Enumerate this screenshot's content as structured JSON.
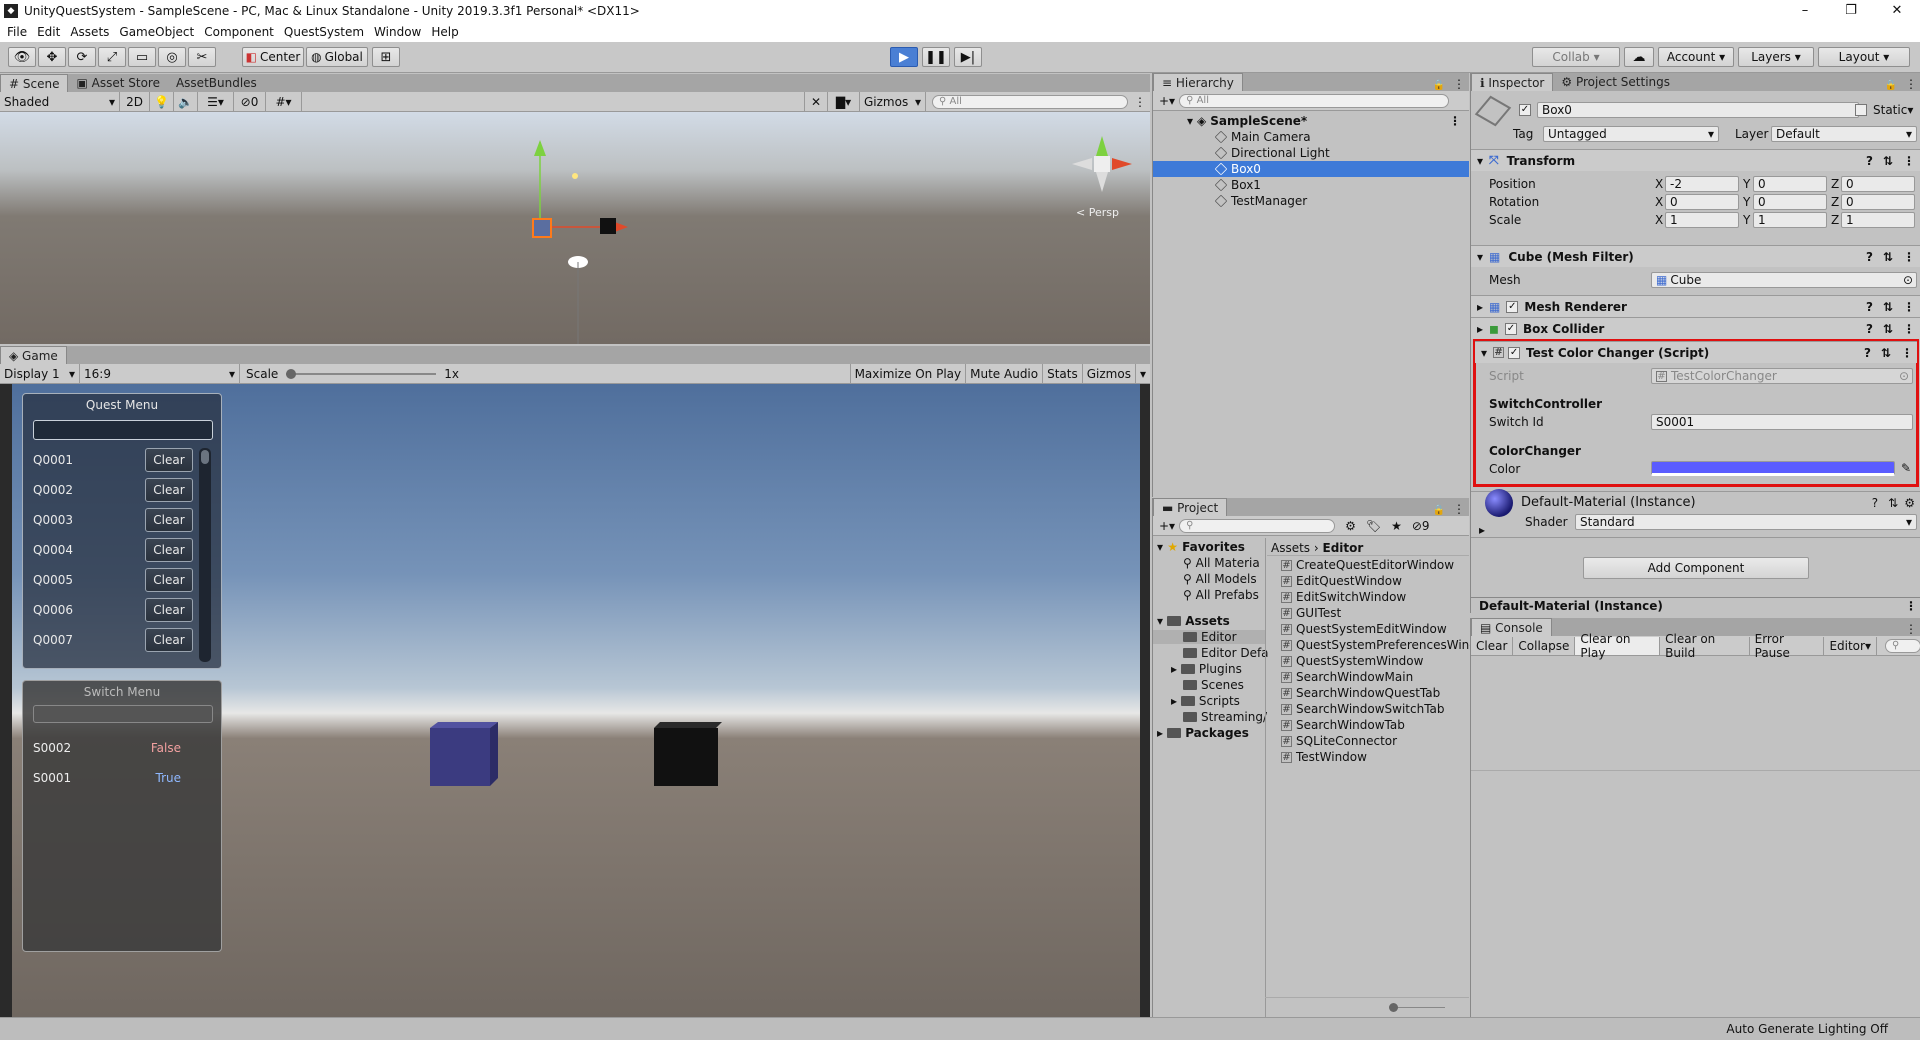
{
  "window": {
    "title": "UnityQuestSystem - SampleScene - PC, Mac & Linux Standalone - Unity 2019.3.3f1 Personal* <DX11>"
  },
  "menu": [
    "File",
    "Edit",
    "Assets",
    "GameObject",
    "Component",
    "QuestSystem",
    "Window",
    "Help"
  ],
  "toolbar": {
    "center": "Center",
    "global": "Global",
    "collab": "Collab",
    "account": "Account",
    "layers": "Layers",
    "layout": "Layout"
  },
  "scene": {
    "tabs": [
      "Scene",
      "Asset Store",
      "AssetBundles"
    ],
    "shading": "Shaded",
    "mode2d": "2D",
    "fx_count": "0",
    "gizmos": "Gizmos",
    "search_placeholder": "All",
    "persp": "< Persp"
  },
  "game": {
    "tab": "Game",
    "display": "Display 1",
    "aspect": "16:9",
    "scale_label": "Scale",
    "scale_value": "1x",
    "buttons": [
      "Maximize On Play",
      "Mute Audio",
      "Stats",
      "Gizmos"
    ]
  },
  "quest_menu": {
    "title": "Quest Menu",
    "items": [
      {
        "id": "Q0001",
        "btn": "Clear"
      },
      {
        "id": "Q0002",
        "btn": "Clear"
      },
      {
        "id": "Q0003",
        "btn": "Clear"
      },
      {
        "id": "Q0004",
        "btn": "Clear"
      },
      {
        "id": "Q0005",
        "btn": "Clear"
      },
      {
        "id": "Q0006",
        "btn": "Clear"
      },
      {
        "id": "Q0007",
        "btn": "Clear"
      }
    ]
  },
  "switch_menu": {
    "title": "Switch Menu",
    "items": [
      {
        "id": "S0002",
        "state": "False",
        "color": "#f2a0a0"
      },
      {
        "id": "S0001",
        "state": "True",
        "color": "#8fb8ff"
      }
    ]
  },
  "hierarchy": {
    "tab": "Hierarchy",
    "search_placeholder": "All",
    "scene": "SampleScene*",
    "items": [
      "Main Camera",
      "Directional Light",
      "Box0",
      "Box1",
      "TestManager"
    ],
    "selected": "Box0"
  },
  "project": {
    "tab": "Project",
    "hidden_count": "9",
    "favorites_label": "Favorites",
    "favorites": [
      "All Materia",
      "All Models",
      "All Prefabs"
    ],
    "assets_label": "Assets",
    "assets_children": [
      "Editor",
      "Editor Defa",
      "Plugins",
      "Scenes",
      "Scripts",
      "Streaming/"
    ],
    "packages_label": "Packages",
    "breadcrumb": [
      "Assets",
      "Editor"
    ],
    "files": [
      "CreateQuestEditorWindow",
      "EditQuestWindow",
      "EditSwitchWindow",
      "GUITest",
      "QuestSystemEditWindow",
      "QuestSystemPreferencesWind",
      "QuestSystemWindow",
      "SearchWindowMain",
      "SearchWindowQuestTab",
      "SearchWindowSwitchTab",
      "SearchWindowTab",
      "SQLiteConnector",
      "TestWindow"
    ]
  },
  "inspector": {
    "tabs": [
      "Inspector",
      "Project Settings"
    ],
    "object_name": "Box0",
    "static_label": "Static",
    "tag_label": "Tag",
    "tag_value": "Untagged",
    "layer_label": "Layer",
    "layer_value": "Default",
    "transform": {
      "title": "Transform",
      "position": {
        "label": "Position",
        "x": "-2",
        "y": "0",
        "z": "0"
      },
      "rotation": {
        "label": "Rotation",
        "x": "0",
        "y": "0",
        "z": "0"
      },
      "scale": {
        "label": "Scale",
        "x": "1",
        "y": "1",
        "z": "1"
      }
    },
    "mesh_filter": {
      "title": "Cube (Mesh Filter)",
      "mesh_label": "Mesh",
      "mesh_value": "Cube"
    },
    "mesh_renderer": "Mesh Renderer",
    "box_collider": "Box Collider",
    "script_comp": {
      "title": "Test Color Changer (Script)",
      "script_label": "Script",
      "script_value": "TestColorChanger",
      "section1": "SwitchController",
      "switch_id_label": "Switch Id",
      "switch_id_value": "S0001",
      "section2": "ColorChanger",
      "color_label": "Color",
      "color_value": "#5a5cff"
    },
    "material": {
      "title": "Default-Material (Instance)",
      "shader_label": "Shader",
      "shader_value": "Standard"
    },
    "add_component": "Add Component",
    "material_footer": "Default-Material (Instance)",
    "highlight_color": "#e01010"
  },
  "console": {
    "tab": "Console",
    "buttons": [
      "Clear",
      "Collapse",
      "Clear on Play",
      "Clear on Build",
      "Error Pause",
      "Editor"
    ]
  },
  "status": {
    "text": "Auto Generate Lighting Off"
  }
}
